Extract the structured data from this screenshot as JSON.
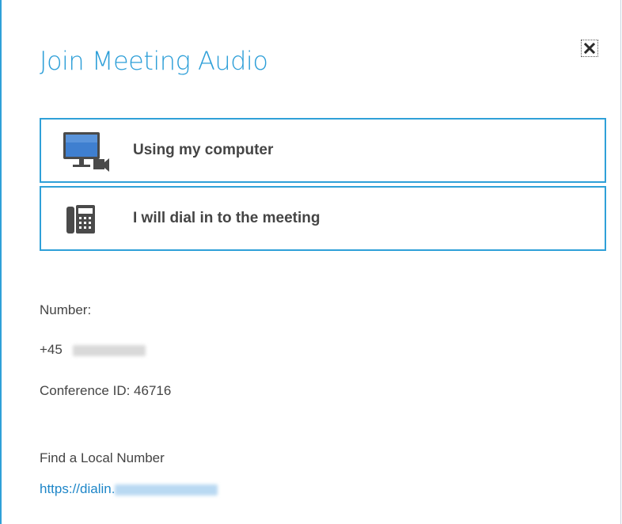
{
  "dialog": {
    "title": "Join Meeting Audio",
    "close_icon": "close-icon",
    "accent_color": "#2fa0d8"
  },
  "options": [
    {
      "label": "Using my computer",
      "icon": "computer-audio-icon"
    },
    {
      "label": "I will dial in to the meeting",
      "icon": "desk-phone-icon"
    }
  ],
  "dialin": {
    "number_label": "Number:",
    "number_prefix": "+45",
    "conference_id": "Conference ID: 46716",
    "local_number_label": "Find a Local Number",
    "link_prefix": "https://dialin."
  }
}
